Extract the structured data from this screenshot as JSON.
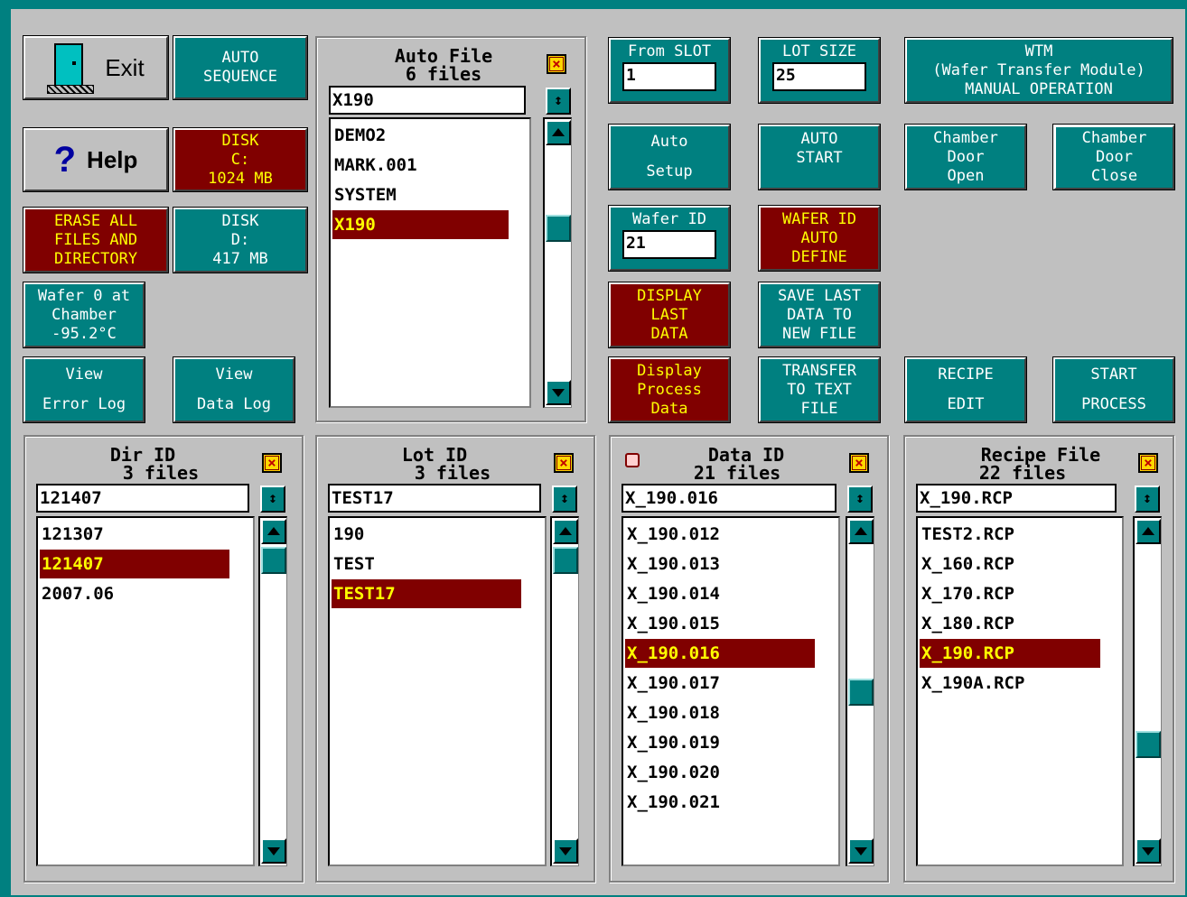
{
  "buttons": {
    "exit": "Exit",
    "auto_sequence": [
      "AUTO",
      "SEQUENCE"
    ],
    "help": "Help",
    "help_icon": "?",
    "disk_c": [
      "DISK",
      "C:",
      "1024 MB"
    ],
    "erase_all": [
      "ERASE ALL",
      "FILES AND",
      "DIRECTORY"
    ],
    "disk_d": [
      "DISK",
      "D:",
      "417 MB"
    ],
    "wafer_status": [
      "Wafer 0 at",
      "Chamber",
      "-95.2°C"
    ],
    "view_error_log": [
      "View",
      "Error Log"
    ],
    "view_data_log": [
      "View",
      "Data Log"
    ],
    "auto_setup": [
      "Auto",
      "Setup"
    ],
    "auto_start": [
      "AUTO",
      "START"
    ],
    "chamber_door_open": [
      "Chamber",
      "Door",
      "Open"
    ],
    "chamber_door_close": [
      "Chamber",
      "Door",
      "Close"
    ],
    "wafer_id_auto": [
      "WAFER ID",
      "AUTO",
      "DEFINE"
    ],
    "display_last_data": [
      "DISPLAY",
      "LAST",
      "DATA"
    ],
    "save_last_data": [
      "SAVE LAST",
      "DATA TO",
      "NEW FILE"
    ],
    "display_process_data": [
      "Display",
      "Process",
      "Data"
    ],
    "transfer_text": [
      "TRANSFER",
      "TO TEXT",
      "FILE"
    ],
    "recipe_edit": [
      "RECIPE",
      "EDIT"
    ],
    "start_process": [
      "START",
      "PROCESS"
    ],
    "wtm": [
      "WTM",
      "(Wafer Transfer Module)",
      "MANUAL OPERATION"
    ]
  },
  "inputs": {
    "from_slot_label": "From SLOT",
    "from_slot_value": "1",
    "lot_size_label": "LOT SIZE",
    "lot_size_value": "25",
    "wafer_id_label": "Wafer ID",
    "wafer_id_value": "21"
  },
  "panels": {
    "auto_file": {
      "title": "Auto File",
      "count": "6 files",
      "field": "X190",
      "items": [
        "DEMO2",
        "MARK.001",
        "SYSTEM",
        "X190"
      ],
      "selected": 3
    },
    "dir_id": {
      "title": "Dir ID",
      "count": "3 files",
      "field": "121407",
      "items": [
        "121307",
        "121407",
        "2007.06"
      ],
      "selected": 1
    },
    "lot_id": {
      "title": "Lot ID",
      "count": "3 files",
      "field": "TEST17",
      "items": [
        "190",
        "TEST",
        "TEST17"
      ],
      "selected": 2
    },
    "data_id": {
      "title": "Data ID",
      "count": "21 files",
      "field": "X_190.016",
      "items": [
        "X_190.012",
        "X_190.013",
        "X_190.014",
        "X_190.015",
        "X_190.016",
        "X_190.017",
        "X_190.018",
        "X_190.019",
        "X_190.020",
        "X_190.021"
      ],
      "selected": 4
    },
    "recipe_file": {
      "title": "Recipe File",
      "count": "22 files",
      "field": "X_190.RCP",
      "items": [
        "TEST2.RCP",
        "X_160.RCP",
        "X_170.RCP",
        "X_180.RCP",
        "X_190.RCP",
        "X_190A.RCP"
      ],
      "selected": 4
    }
  },
  "glyphs": {
    "close": "×",
    "spin": "↕"
  },
  "colors": {
    "teal": "#008080",
    "maroon": "#800000",
    "yellow": "#ffff00",
    "face": "#c0c0c0"
  }
}
